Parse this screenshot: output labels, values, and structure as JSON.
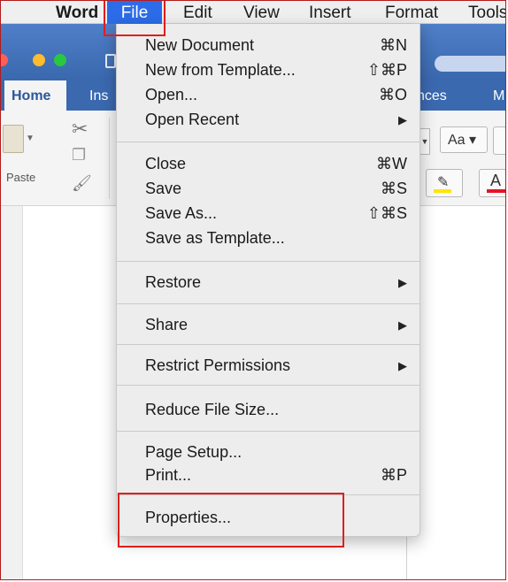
{
  "menubar": {
    "apple": "",
    "app": "Word",
    "file": "File",
    "edit": "Edit",
    "view": "View",
    "insert": "Insert",
    "format": "Format",
    "tools": "Tools"
  },
  "ribbon": {
    "home_tab": "Home",
    "insert_tab_partial": "Ins",
    "references_tab_partial": "nces",
    "more_tab_partial": "M",
    "paste_label": "Paste",
    "font_grow_label": "Aa"
  },
  "file_menu": {
    "items": [
      {
        "label": "New Document",
        "shortcut": "⌘N"
      },
      {
        "label": "New from Template...",
        "shortcut": "⇧⌘P"
      },
      {
        "label": "Open...",
        "shortcut": "⌘O"
      },
      {
        "label": "Open Recent",
        "submenu": true
      },
      {
        "label": "Close",
        "shortcut": "⌘W"
      },
      {
        "label": "Save",
        "shortcut": "⌘S"
      },
      {
        "label": "Save As...",
        "shortcut": "⇧⌘S"
      },
      {
        "label": "Save as Template..."
      },
      {
        "label": "Restore",
        "submenu": true
      },
      {
        "label": "Share",
        "submenu": true
      },
      {
        "label": "Restrict Permissions",
        "submenu": true
      },
      {
        "label": "Reduce File Size..."
      },
      {
        "label": "Page Setup..."
      },
      {
        "label": "Print...",
        "shortcut": "⌘P"
      },
      {
        "label": "Properties..."
      }
    ],
    "submenu_arrow": "▶"
  },
  "colors": {
    "menu_highlight": "#2c6ce8",
    "annotation_red": "#e01e1e",
    "title_bar_blue": "#3b69b0",
    "highlighter_yellow": "#ffe600",
    "font_color_red": "#e81123"
  },
  "icons": {
    "paste": "clipboard-icon",
    "cut": "scissors-icon",
    "copy": "copy-icon",
    "format_painter": "brush-icon",
    "highlight": "highlighter-icon",
    "font_color": "font-color-icon"
  }
}
